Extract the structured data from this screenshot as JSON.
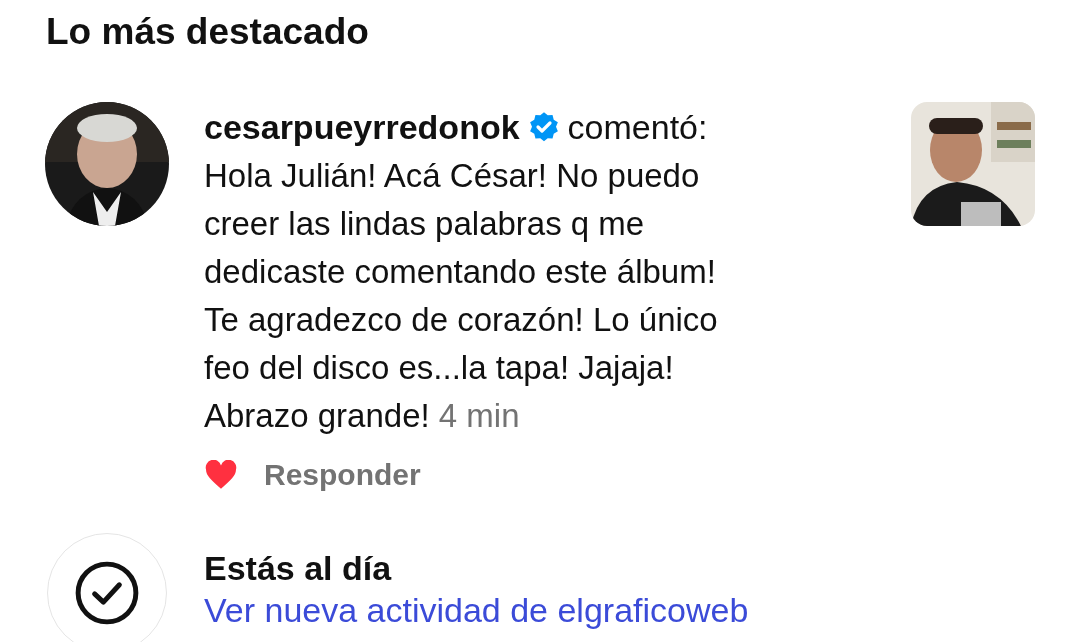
{
  "section_title": "Lo más destacado",
  "notification": {
    "username": "cesarpueyrredonok",
    "verified": true,
    "action": "comentó:",
    "comment": "Hola Julián! Acá César! No puedo\ncreer las lindas palabras q me\ndedicaste comentando este álbum!\nTe agradezco de corazón! Lo único\nfeo del disco es...la tapa! Jajaja!\nAbrazo grande!",
    "time": "4 min",
    "liked": true,
    "reply": "Responder"
  },
  "caught_up": {
    "title": "Estás al día",
    "link": "Ver nueva actividad de elgraficoweb"
  }
}
